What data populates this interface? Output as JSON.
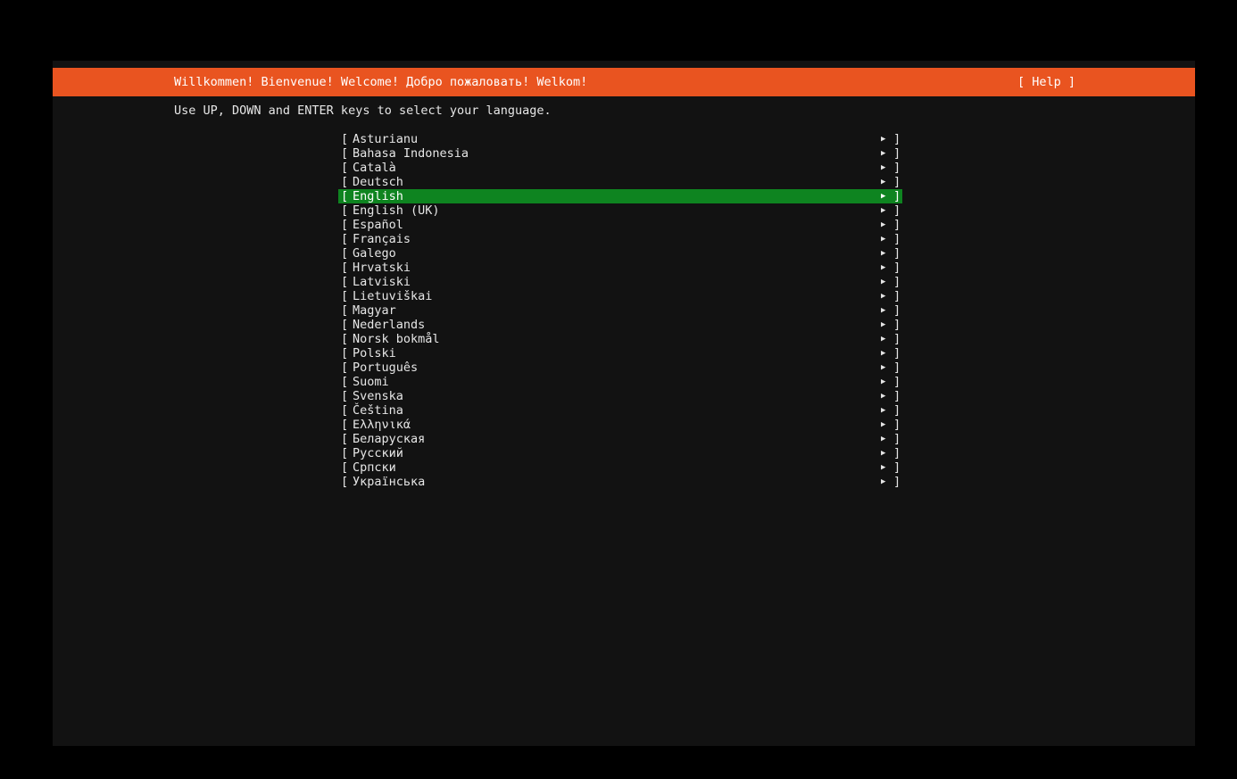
{
  "header": {
    "title": "Willkommen! Bienvenue! Welcome! Добро пожаловать! Welkom!",
    "help_label": "[ Help ]"
  },
  "instructions": "Use UP, DOWN and ENTER keys to select your language.",
  "list": {
    "open_bracket": "[",
    "close_bracket": "]",
    "arrow_icon": "▶",
    "selected_index": 4,
    "items": [
      {
        "label": "Asturianu"
      },
      {
        "label": "Bahasa Indonesia"
      },
      {
        "label": "Català"
      },
      {
        "label": "Deutsch"
      },
      {
        "label": "English"
      },
      {
        "label": "English (UK)"
      },
      {
        "label": "Español"
      },
      {
        "label": "Français"
      },
      {
        "label": "Galego"
      },
      {
        "label": "Hrvatski"
      },
      {
        "label": "Latviski"
      },
      {
        "label": "Lietuviškai"
      },
      {
        "label": "Magyar"
      },
      {
        "label": "Nederlands"
      },
      {
        "label": "Norsk bokmål"
      },
      {
        "label": "Polski"
      },
      {
        "label": "Português"
      },
      {
        "label": "Suomi"
      },
      {
        "label": "Svenska"
      },
      {
        "label": "Čeština"
      },
      {
        "label": "Ελληνικά"
      },
      {
        "label": "Беларуская"
      },
      {
        "label": "Русский"
      },
      {
        "label": "Српски"
      },
      {
        "label": "Українська"
      }
    ]
  },
  "colors": {
    "header_bg": "#e95420",
    "selected_bg": "#0e8420",
    "screen_bg": "#121212",
    "outer_bg": "#000000",
    "text": "#e6e6e6"
  }
}
